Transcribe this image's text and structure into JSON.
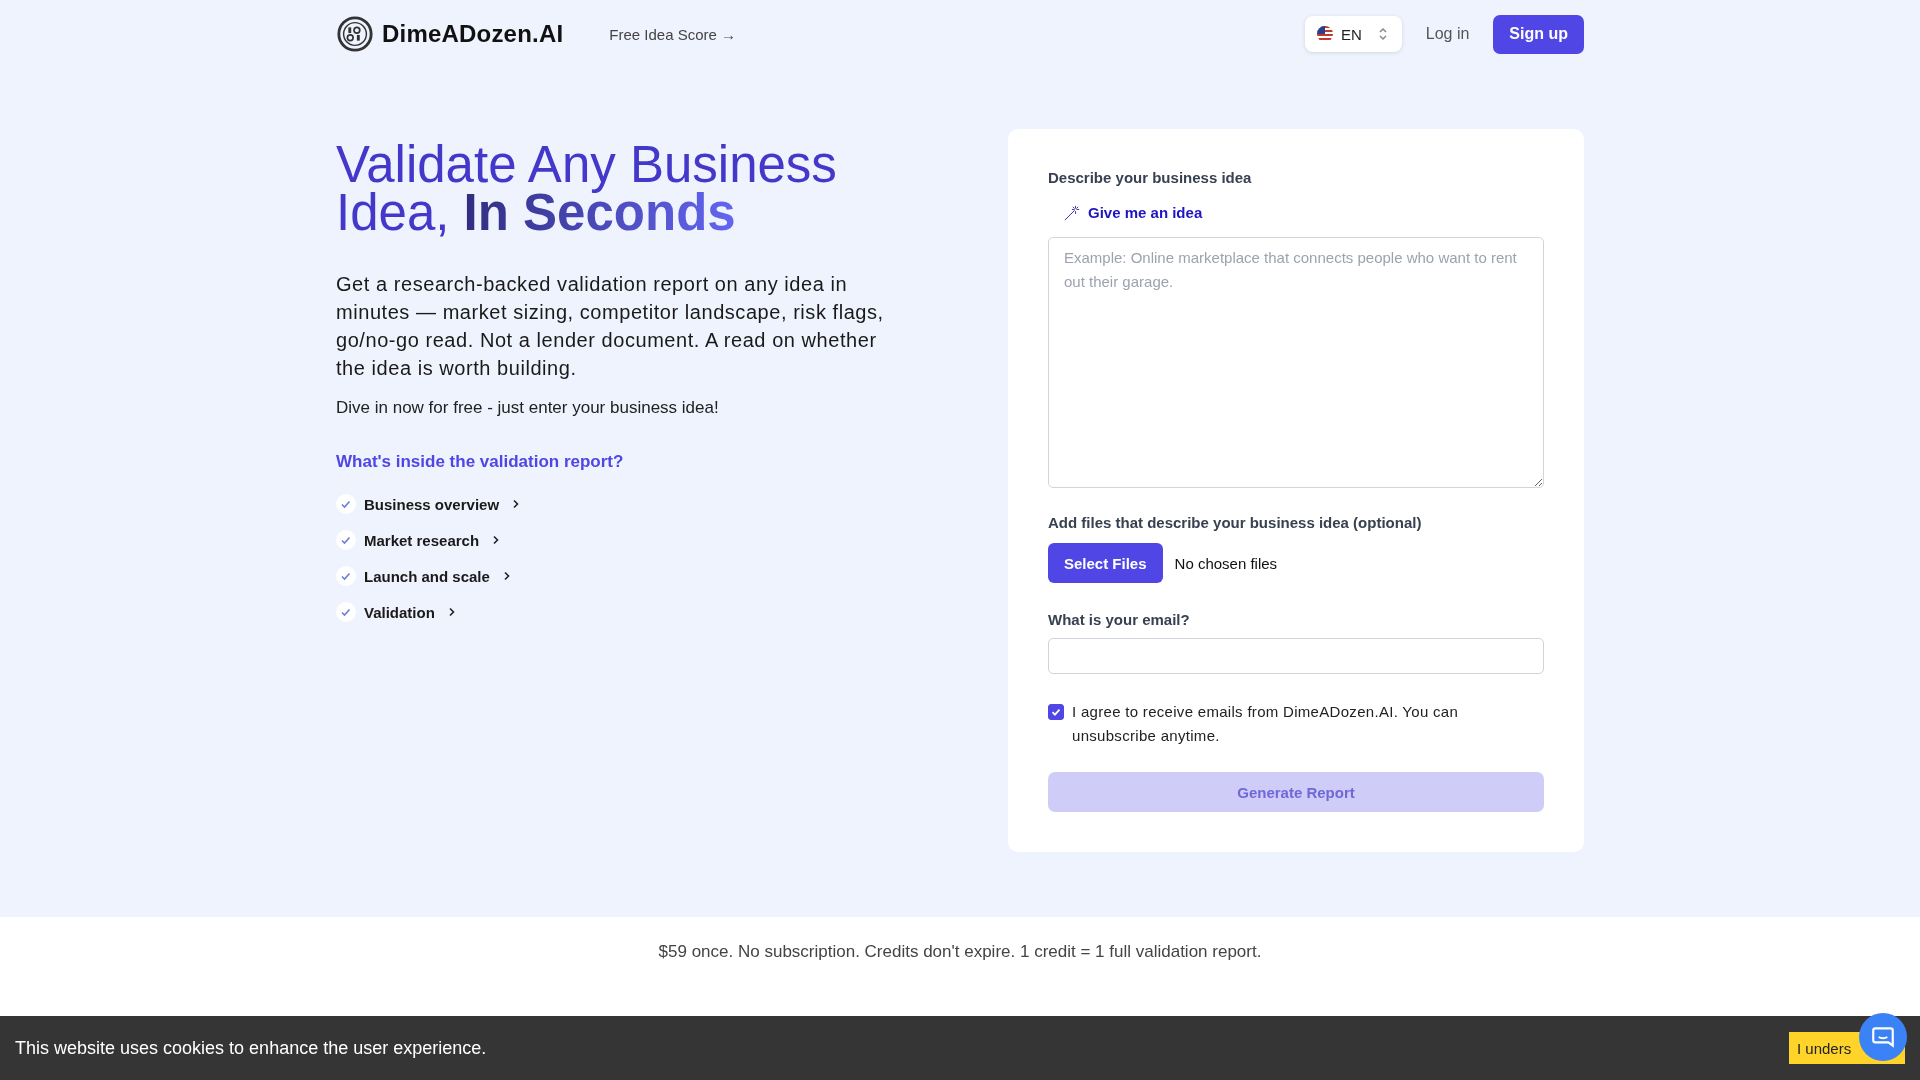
{
  "header": {
    "brand": "DimeADozen.AI",
    "nav_link": "Free Idea Score →",
    "language": "EN",
    "login": "Log in",
    "signup": "Sign up"
  },
  "hero": {
    "title": "Validate Any Business Idea, **In Seconds**",
    "description": "Get a research-backed validation report on any idea in minutes — market sizing, competitor landscape, risk flags, go/no-go read. Not a lender document. A read on whether the idea is worth building.",
    "cta_text": "Dive in now for free - just enter your business idea!",
    "report_heading": "What's inside the validation report?",
    "report_items": [
      {
        "label": "Business overview",
        "expanded": false
      },
      {
        "label": "Market research",
        "expanded": false
      },
      {
        "label": "Launch and scale",
        "expanded": false
      },
      {
        "label": "Validation",
        "expanded": false
      }
    ]
  },
  "form": {
    "idea_label": "Describe your business idea",
    "idea_button": "Give me an idea",
    "idea_placeholder": "Example: Online marketplace that connects people who want to rent out their garage.",
    "files_label": "Add files that describe your business idea (optional)",
    "files_button": "Select Files",
    "files_status": "No chosen files",
    "email_label": "What is your email?",
    "consent": {
      "label": "I agree to receive emails from DimeADozen.AI. You can unsubscribe anytime.",
      "checked": true
    },
    "submit": {
      "label": "Generate Report",
      "disabled": true
    }
  },
  "pricing_note": "$59 once. No subscription. Credits don't expire. 1 credit = 1 full validation report.",
  "cookie_banner": {
    "message": "This website uses cookies to enhance the user experience.",
    "button": "I unders"
  }
}
